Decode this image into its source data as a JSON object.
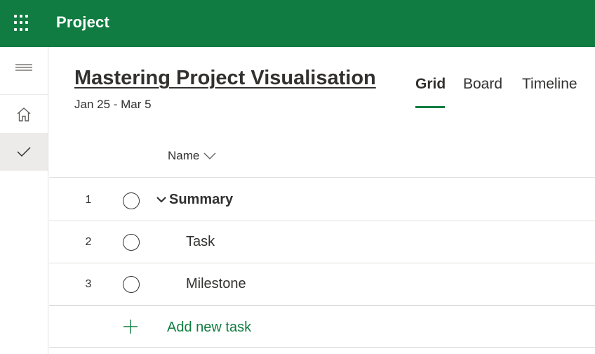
{
  "app": {
    "title": "Project"
  },
  "project": {
    "title": "Mastering Project Visualisation",
    "dates": "Jan 25 - Mar 5"
  },
  "tabs": [
    {
      "label": "Grid",
      "active": true
    },
    {
      "label": "Board",
      "active": false
    },
    {
      "label": "Timeline",
      "active": false
    }
  ],
  "grid": {
    "column_header": "Name",
    "rows": [
      {
        "num": "1",
        "name": "Summary",
        "type": "summary",
        "expanded": true
      },
      {
        "num": "2",
        "name": "Task",
        "type": "task"
      },
      {
        "num": "3",
        "name": "Milestone",
        "type": "milestone"
      }
    ],
    "add_label": "Add new task"
  },
  "icons": {
    "app_launcher": "waffle-icon",
    "menu": "hamburger-icon",
    "home": "home-icon",
    "tasks": "checkmark-icon",
    "sort": "chevron-down-icon",
    "expand": "chevron-down-icon",
    "add": "plus-icon"
  },
  "colors": {
    "brand": "#107c41",
    "text": "#323130",
    "divider": "#e1dfdd",
    "selected_rail": "#edebe9"
  }
}
